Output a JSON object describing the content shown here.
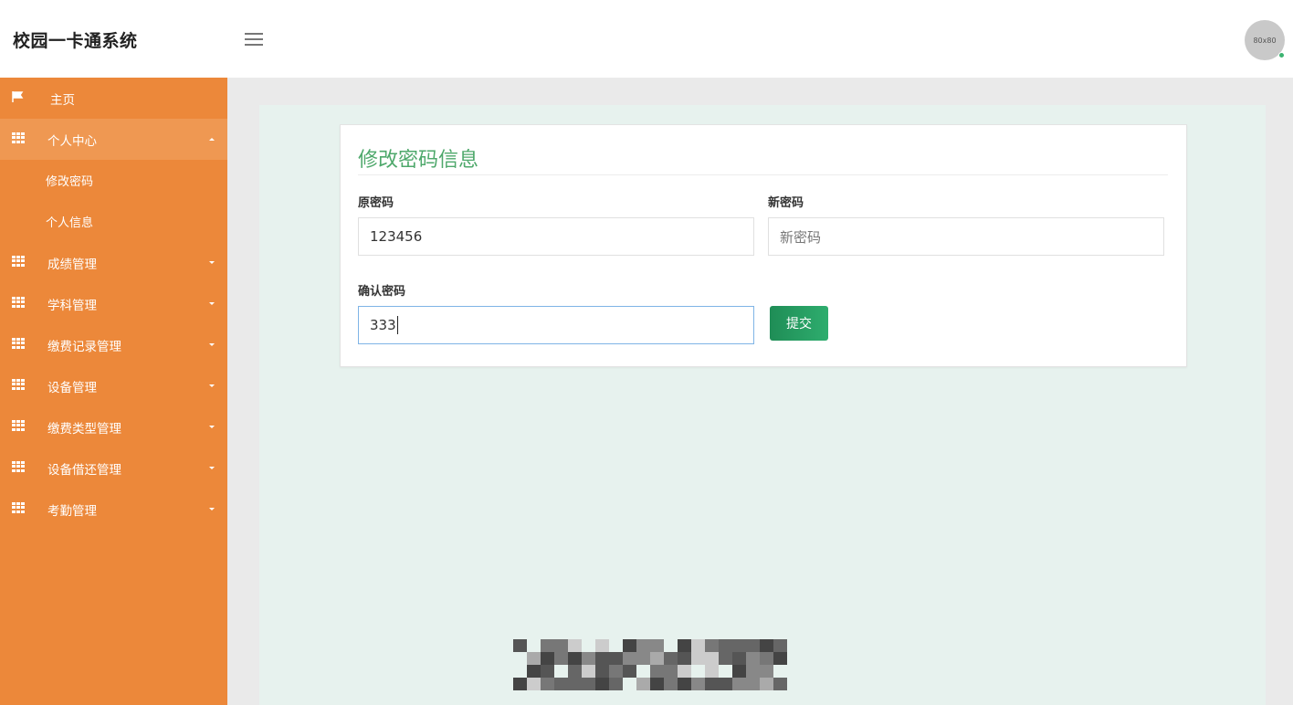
{
  "app": {
    "title": "校园一卡通系统"
  },
  "header": {
    "avatar_text": "80x80"
  },
  "sidebar": {
    "home": "主页",
    "personal": {
      "label": "个人中心",
      "children": [
        "修改密码",
        "个人信息"
      ]
    },
    "items": [
      {
        "label": "成绩管理"
      },
      {
        "label": "学科管理"
      },
      {
        "label": "缴费记录管理"
      },
      {
        "label": "设备管理"
      },
      {
        "label": "缴费类型管理"
      },
      {
        "label": "设备借还管理"
      },
      {
        "label": "考勤管理"
      }
    ]
  },
  "form": {
    "title": "修改密码信息",
    "old_password": {
      "label": "原密码",
      "value": "123456"
    },
    "new_password": {
      "label": "新密码",
      "placeholder": "新密码",
      "value": ""
    },
    "confirm_password": {
      "label": "确认密码",
      "value": "333"
    },
    "submit_label": "提交"
  },
  "colors": {
    "sidebar_bg": "#ec883a",
    "title_green": "#4ea86b",
    "button_green": "#2ead6e",
    "content_bg": "#e7f2ee"
  }
}
